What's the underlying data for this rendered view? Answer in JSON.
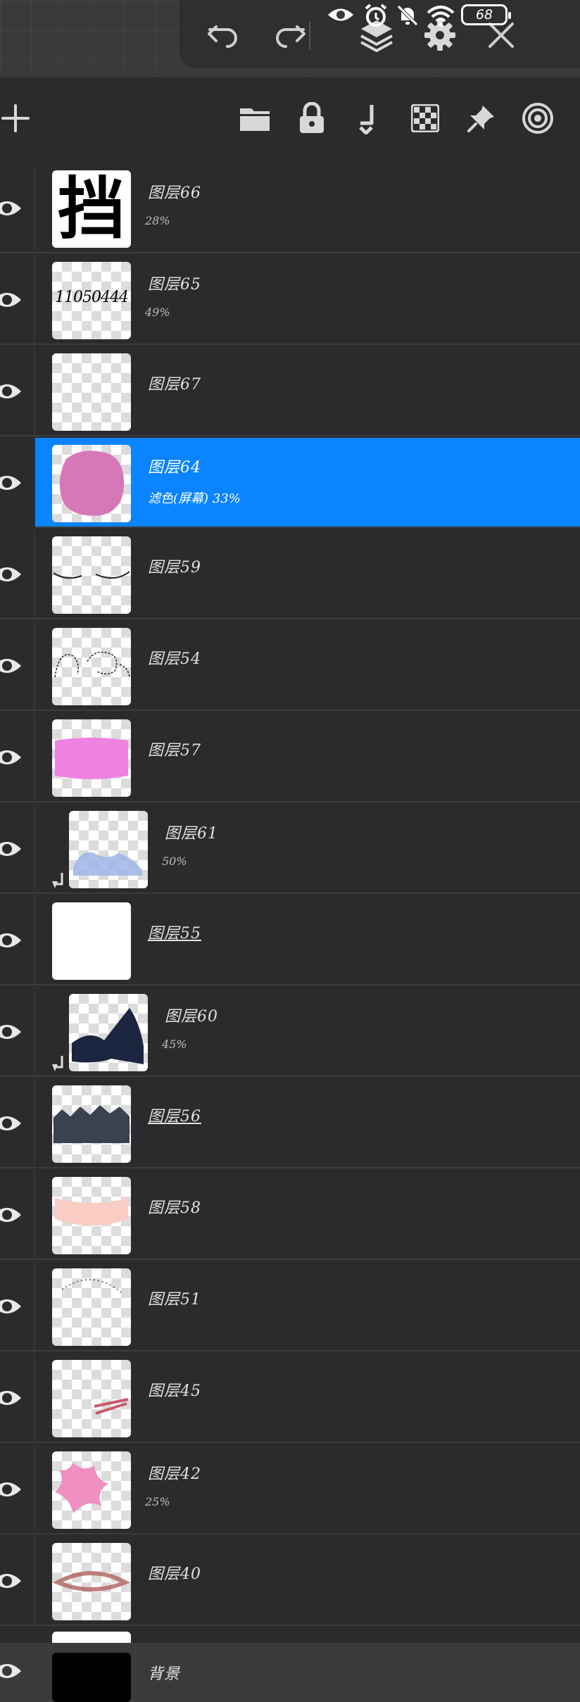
{
  "status_bar": {
    "battery_level": "68",
    "icons": [
      "eye-icon",
      "alarm-icon",
      "mute-icon",
      "wifi-icon"
    ]
  },
  "toolbar": {
    "buttons": [
      "undo-icon",
      "redo-icon",
      "layers-icon",
      "settings-icon",
      "close-icon"
    ]
  },
  "layer_panel": {
    "header_buttons": [
      "add-icon",
      "folder-icon",
      "lock-icon",
      "clip-icon",
      "checker-icon",
      "pin-icon",
      "target-icon"
    ],
    "layers": [
      {
        "name": "图层66",
        "sub": "28%",
        "clipped": false,
        "active": false,
        "underline": false
      },
      {
        "name": "图层65",
        "sub": "49%",
        "clipped": false,
        "active": false,
        "underline": false,
        "thumb_text": "11050444"
      },
      {
        "name": "图层67",
        "sub": "",
        "clipped": false,
        "active": false,
        "underline": false
      },
      {
        "name": "图层64",
        "sub": "滤色(屏幕)   33%",
        "clipped": false,
        "active": true,
        "underline": false
      },
      {
        "name": "图层59",
        "sub": "",
        "clipped": false,
        "active": false,
        "underline": false
      },
      {
        "name": "图层54",
        "sub": "",
        "clipped": false,
        "active": false,
        "underline": false
      },
      {
        "name": "图层57",
        "sub": "",
        "clipped": false,
        "active": false,
        "underline": false
      },
      {
        "name": "图层61",
        "sub": "50%",
        "clipped": true,
        "active": false,
        "underline": false
      },
      {
        "name": "图层55",
        "sub": "",
        "clipped": false,
        "active": false,
        "underline": true
      },
      {
        "name": "图层60",
        "sub": "45%",
        "clipped": true,
        "active": false,
        "underline": false
      },
      {
        "name": "图层56",
        "sub": "",
        "clipped": false,
        "active": false,
        "underline": true
      },
      {
        "name": "图层58",
        "sub": "",
        "clipped": false,
        "active": false,
        "underline": false
      },
      {
        "name": "图层51",
        "sub": "",
        "clipped": false,
        "active": false,
        "underline": false
      },
      {
        "name": "图层45",
        "sub": "",
        "clipped": false,
        "active": false,
        "underline": false
      },
      {
        "name": "图层42",
        "sub": "25%",
        "clipped": false,
        "active": false,
        "underline": false
      },
      {
        "name": "图层40",
        "sub": "",
        "clipped": false,
        "active": false,
        "underline": false
      }
    ],
    "background_layer": {
      "name": "背景"
    },
    "thumb_glyph": "挡"
  },
  "colors": {
    "active_row": "#0a84ff",
    "panel_bg": "#2b2b2d"
  }
}
